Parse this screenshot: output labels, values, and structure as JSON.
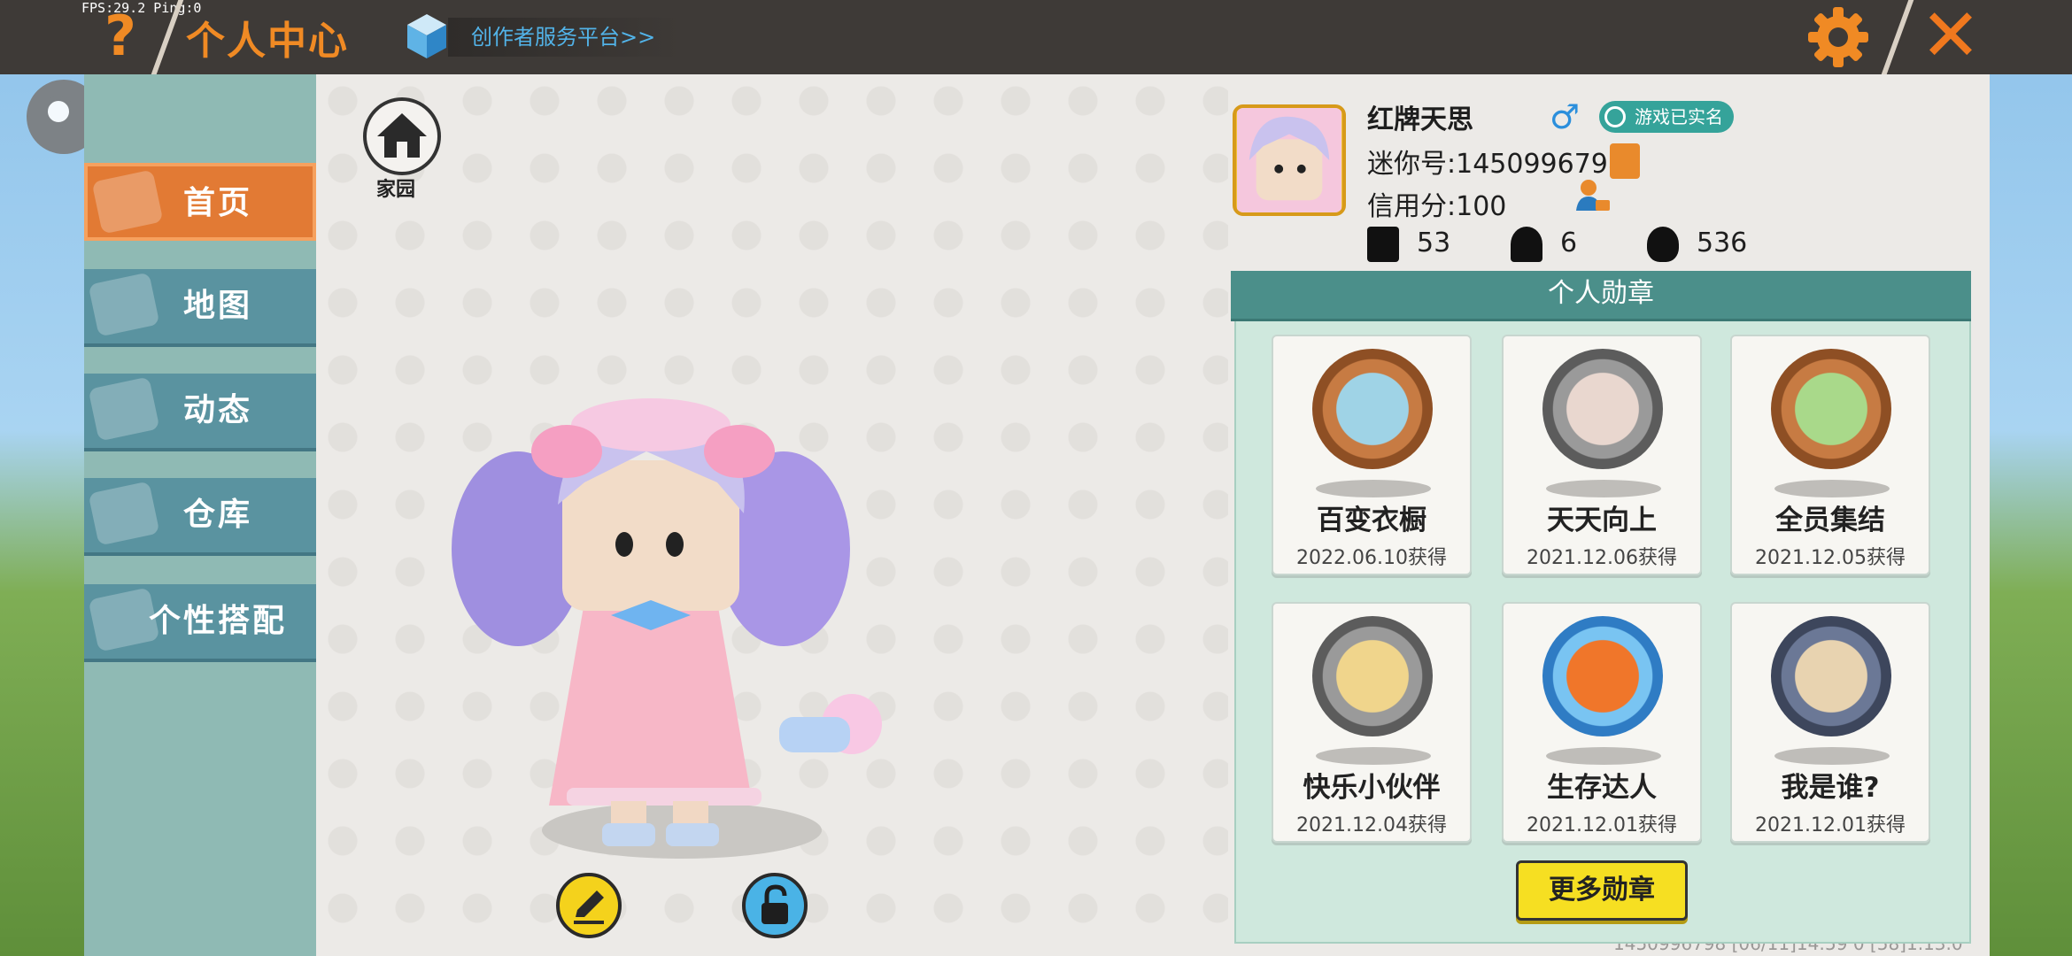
{
  "status": {
    "fps_ping": "FPS:29.2  Ping:0"
  },
  "header": {
    "help_icon": "question-mark-icon",
    "title": "个人中心",
    "creator_link": "创作者服务平台>>",
    "settings_icon": "gear-icon",
    "close_icon": "close-x-icon"
  },
  "sidebar": {
    "items": [
      {
        "label": "首页",
        "active": true
      },
      {
        "label": "地图",
        "active": false
      },
      {
        "label": "动态",
        "active": false
      },
      {
        "label": "仓库",
        "active": false
      },
      {
        "label": "个性搭配",
        "active": false
      }
    ]
  },
  "home": {
    "label": "家园"
  },
  "profile": {
    "name": "红牌天思",
    "gender_icon": "male-icon",
    "realname_badge": "游戏已实名",
    "mini_id": "迷你号:1450996798",
    "credit": "信用分:100",
    "stats": {
      "likes": "53",
      "fans": "6",
      "heat": "536"
    }
  },
  "medals": {
    "title": "个人勋章",
    "items": [
      {
        "name": "百变衣橱",
        "date": "2022.06.10获得",
        "color": "#c77b43"
      },
      {
        "name": "天天向上",
        "date": "2021.12.06获得",
        "color": "#8f8f8f"
      },
      {
        "name": "全员集结",
        "date": "2021.12.05获得",
        "color": "#c77b43"
      },
      {
        "name": "快乐小伙伴",
        "date": "2021.12.04获得",
        "color": "#8f8f8f"
      },
      {
        "name": "生存达人",
        "date": "2021.12.01获得",
        "color": "#4aa8e6"
      },
      {
        "name": "我是谁?",
        "date": "2021.12.01获得",
        "color": "#6b7896"
      }
    ],
    "more_button": "更多勋章"
  },
  "footer": {
    "text": "1450996798    [06/11]14:59 0  [58]1.13.0"
  },
  "colors": {
    "accent": "#f08a24",
    "nav": "#5a93a0",
    "nav_active": "#e27a34",
    "medal_header": "#4b8f8a"
  }
}
